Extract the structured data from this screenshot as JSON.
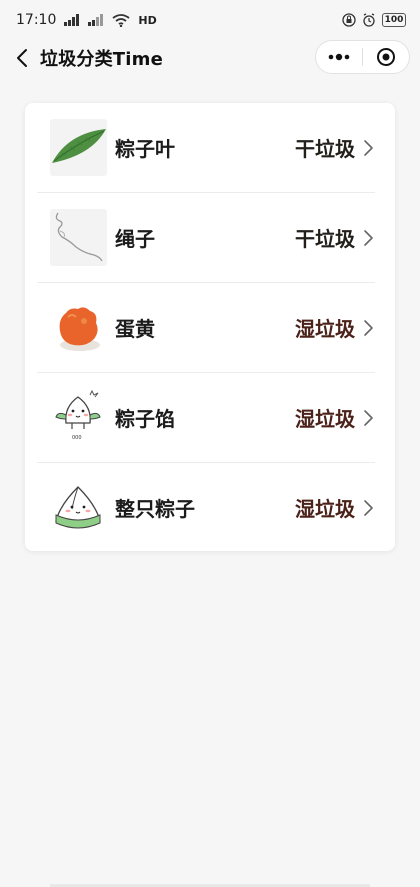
{
  "status_bar": {
    "time": "17:10",
    "network": "4G",
    "volte": "HD",
    "battery": "100"
  },
  "nav": {
    "title": "垃圾分类Time"
  },
  "items": [
    {
      "name": "粽子叶",
      "category": "干垃圾",
      "category_color": "#231f1a",
      "icon": "bamboo-leaf-icon"
    },
    {
      "name": "绳子",
      "category": "干垃圾",
      "category_color": "#231f1a",
      "icon": "rope-icon"
    },
    {
      "name": "蛋黄",
      "category": "湿垃圾",
      "category_color": "#4b2219",
      "icon": "egg-yolk-icon"
    },
    {
      "name": "粽子馅",
      "category": "湿垃圾",
      "category_color": "#4b2219",
      "icon": "dumpling-filling-icon"
    },
    {
      "name": "整只粽子",
      "category": "湿垃圾",
      "category_color": "#4b2219",
      "icon": "zongzi-icon"
    }
  ]
}
